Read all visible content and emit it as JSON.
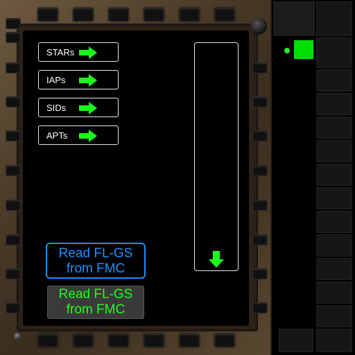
{
  "menu": {
    "items": [
      {
        "label": "STARs"
      },
      {
        "label": "IAPs"
      },
      {
        "label": "SIDs"
      },
      {
        "label": "APTs"
      }
    ]
  },
  "actions": {
    "read_active": "Read FL-GS from FMC",
    "read_inactive": "Read FL-GS from FMC"
  },
  "icons": {
    "menu_arrow": "right-arrow-icon",
    "list_arrow": "down-arrow-icon"
  },
  "colors": {
    "arrow_green": "#1aff1a",
    "active_blue": "#1e90ff",
    "indicator_green": "#00e000"
  }
}
